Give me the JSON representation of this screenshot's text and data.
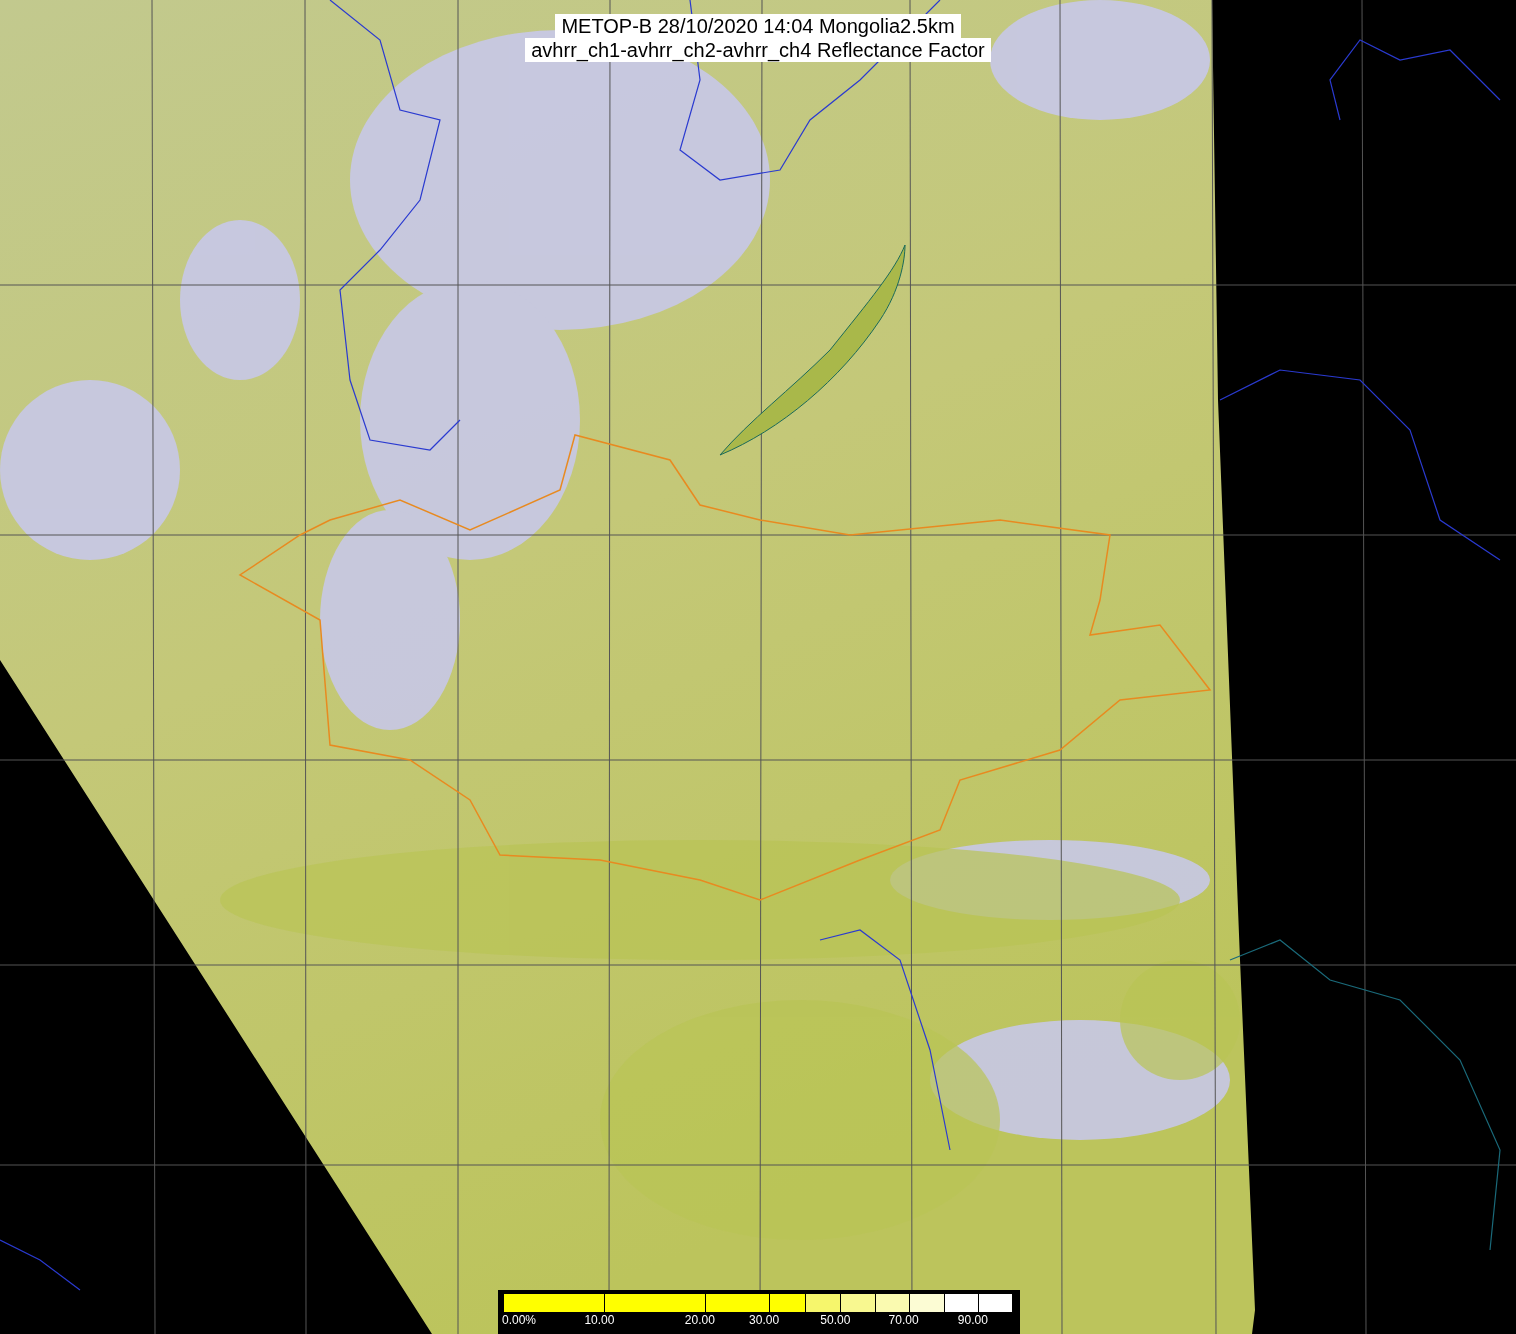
{
  "title": "METOP-B 28/10/2020 14:04 Mongolia2.5km",
  "subtitle": "avhrr_ch1-avhrr_ch2-avhrr_ch4 Reflectance Factor",
  "colorbar": {
    "segments": [
      {
        "color": "#ffff00"
      },
      {
        "color": "#ffff00"
      },
      {
        "color": "#ffff00"
      },
      {
        "color": "#ffff00"
      },
      {
        "color": "#f6f66c"
      },
      {
        "color": "#f8f890"
      },
      {
        "color": "#fafab0"
      },
      {
        "color": "#fcfcd4"
      },
      {
        "color": "#ffffff"
      },
      {
        "color": "#ffffff"
      }
    ],
    "labels": [
      "0.00%",
      "10.00",
      "20.00",
      "30.00",
      "50.00",
      "70.00",
      "90.00"
    ]
  }
}
